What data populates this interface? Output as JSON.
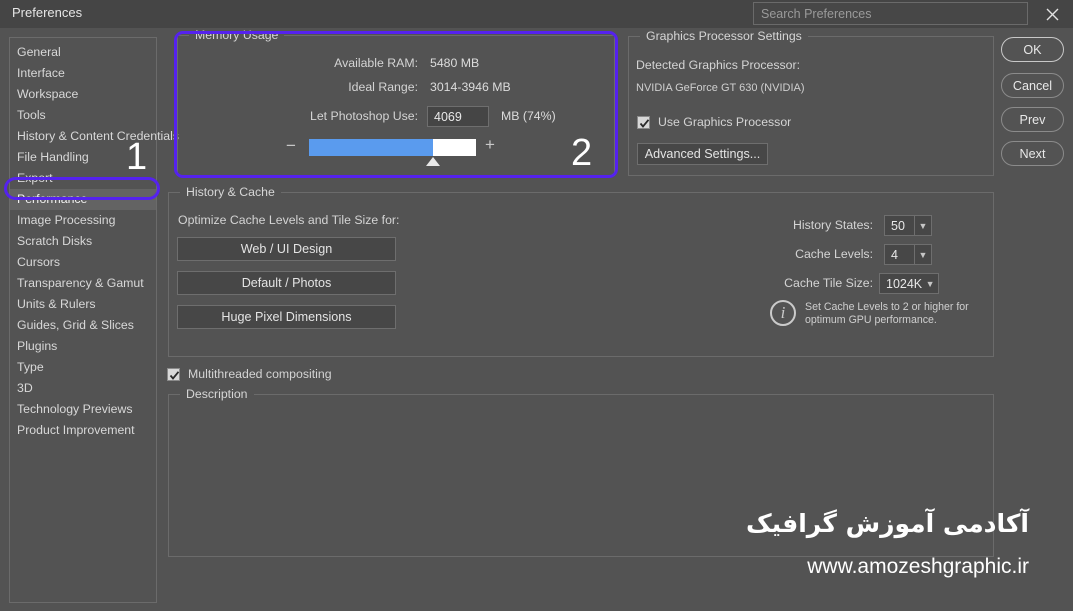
{
  "window": {
    "title": "Preferences",
    "close_icon": "close-icon"
  },
  "search": {
    "placeholder": "Search Preferences",
    "value": ""
  },
  "sidebar": {
    "items": [
      {
        "label": "General",
        "selected": false
      },
      {
        "label": "Interface",
        "selected": false
      },
      {
        "label": "Workspace",
        "selected": false
      },
      {
        "label": "Tools",
        "selected": false
      },
      {
        "label": "History & Content Credentials",
        "selected": false
      },
      {
        "label": "File Handling",
        "selected": false
      },
      {
        "label": "Export",
        "selected": false
      },
      {
        "label": "Performance",
        "selected": true
      },
      {
        "label": "Image Processing",
        "selected": false
      },
      {
        "label": "Scratch Disks",
        "selected": false
      },
      {
        "label": "Cursors",
        "selected": false
      },
      {
        "label": "Transparency & Gamut",
        "selected": false
      },
      {
        "label": "Units & Rulers",
        "selected": false
      },
      {
        "label": "Guides, Grid & Slices",
        "selected": false
      },
      {
        "label": "Plugins",
        "selected": false
      },
      {
        "label": "Type",
        "selected": false
      },
      {
        "label": "3D",
        "selected": false
      },
      {
        "label": "Technology Previews",
        "selected": false
      },
      {
        "label": "Product Improvement",
        "selected": false
      }
    ]
  },
  "annotations": {
    "step1": "1",
    "step2": "2",
    "highlight_color": "#5522ee"
  },
  "memory_usage": {
    "title": "Memory Usage",
    "available_ram_label": "Available RAM:",
    "available_ram_value": "5480 MB",
    "ideal_range_label": "Ideal Range:",
    "ideal_range_value": "3014-3946 MB",
    "let_use_label": "Let Photoshop Use:",
    "let_use_value": "4069",
    "let_use_suffix": "MB (74%)",
    "slider_percent": 74,
    "minus_icon": "minus-icon",
    "plus_icon": "plus-icon"
  },
  "graphics": {
    "title": "Graphics Processor Settings",
    "detected_label": "Detected Graphics Processor:",
    "detected_value": "NVIDIA GeForce GT 630 (NVIDIA)",
    "use_gpu_label": "Use Graphics Processor",
    "use_gpu_checked": true,
    "advanced_button": "Advanced Settings..."
  },
  "history_cache": {
    "title": "History & Cache",
    "optimize_label": "Optimize Cache Levels and Tile Size for:",
    "preset_buttons": [
      "Web / UI Design",
      "Default / Photos",
      "Huge Pixel Dimensions"
    ],
    "history_states_label": "History States:",
    "history_states_value": "50",
    "cache_levels_label": "Cache Levels:",
    "cache_levels_value": "4",
    "cache_tile_label": "Cache Tile Size:",
    "cache_tile_value": "1024K",
    "info_icon": "info-icon",
    "info_text_line1": "Set Cache Levels to 2 or higher for",
    "info_text_line2": "optimum GPU performance."
  },
  "multithreaded": {
    "label": "Multithreaded compositing",
    "checked": true
  },
  "description": {
    "title": "Description",
    "body": ""
  },
  "dialog_buttons": [
    {
      "label": "OK",
      "primary": true
    },
    {
      "label": "Cancel",
      "primary": false
    },
    {
      "label": "Prev",
      "primary": false
    },
    {
      "label": "Next",
      "primary": false
    }
  ],
  "watermark": {
    "persian": "آکادمی آموزش گرافیک",
    "url": "www.amozeshgraphic.ir"
  }
}
